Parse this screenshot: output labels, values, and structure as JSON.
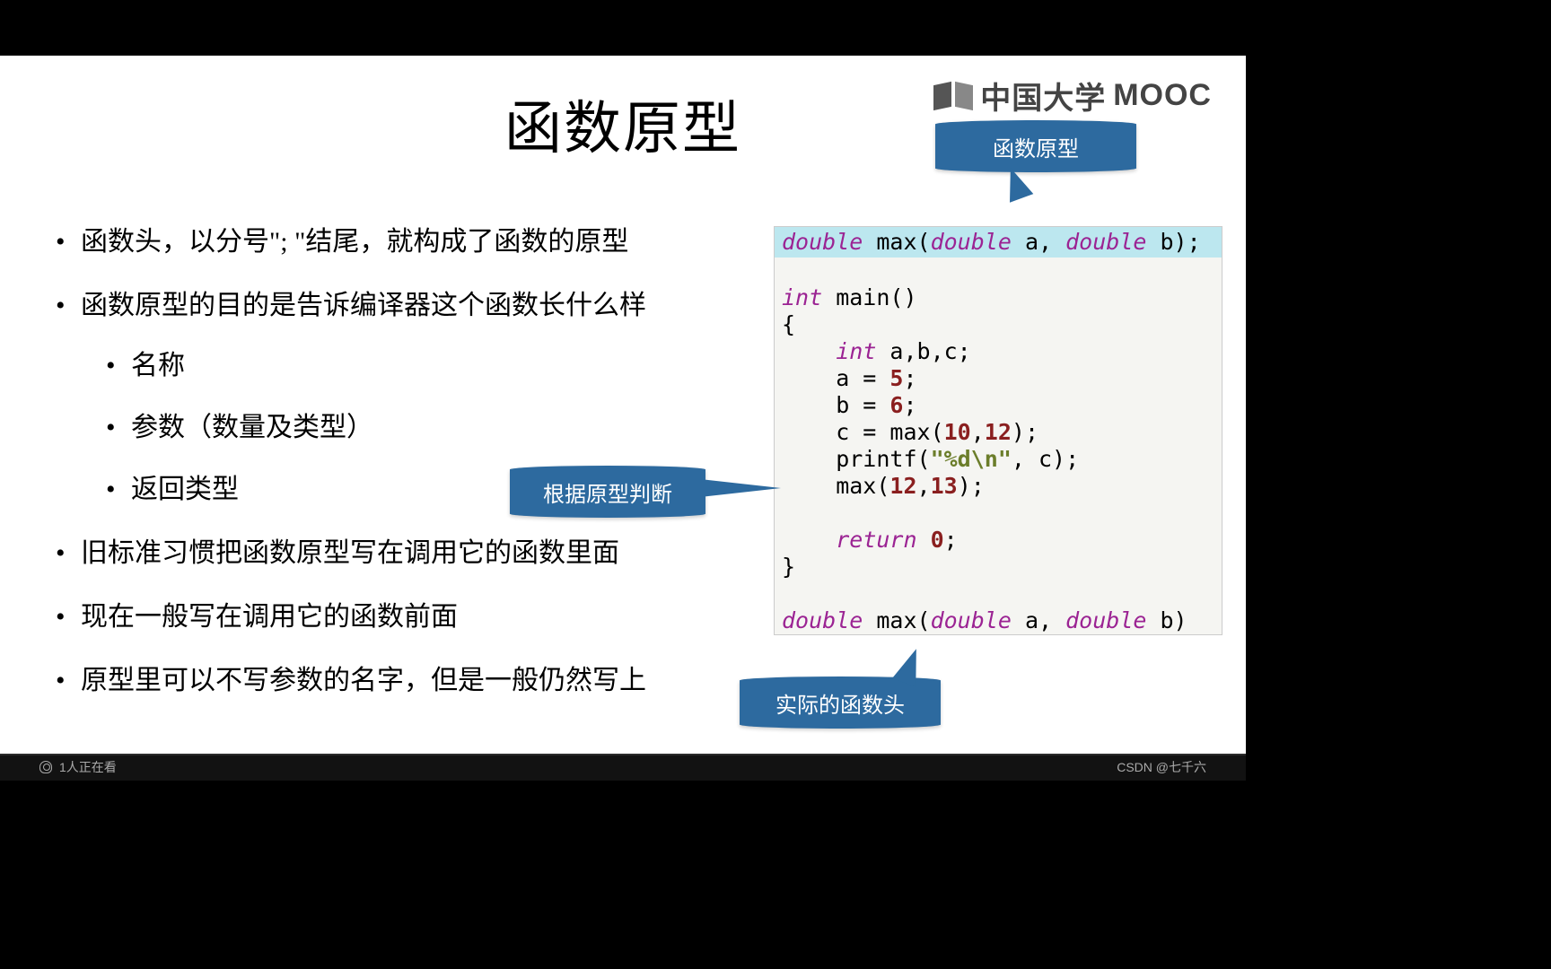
{
  "slide": {
    "title": "函数原型",
    "bullets": {
      "b1": "函数头，以分号\"; \"结尾，就构成了函数的原型",
      "b2": "函数原型的目的是告诉编译器这个函数长什么样",
      "b2a": "名称",
      "b2b": "参数（数量及类型）",
      "b2c": "返回类型",
      "b3": "旧标准习惯把函数原型写在调用它的函数里面",
      "b4": "现在一般写在调用它的函数前面",
      "b5": "原型里可以不写参数的名字，但是一般仍然写上"
    },
    "callouts": {
      "c1": "函数原型",
      "c2": "根据原型判断",
      "c3": "实际的函数头"
    },
    "code": {
      "proto_kw1": "double",
      "proto_fn": " max(",
      "proto_kw2": "double",
      "proto_a": " a, ",
      "proto_kw3": "double",
      "proto_b": " b);",
      "main_kw": "int",
      "main_sig": " main()",
      "brace_open": "{",
      "decl_kw": "int",
      "decl": " a,b,c;",
      "assign_a_l": "    a = ",
      "assign_a_n": "5",
      "semi": ";",
      "assign_b_l": "    b = ",
      "assign_b_n": "6",
      "assign_c_l": "    c = max(",
      "assign_c_n1": "10",
      "comma": ",",
      "assign_c_n2": "12",
      "rparen_semi": ");",
      "printf_l": "    printf(",
      "printf_str": "\"%d\\n\"",
      "printf_r": ", c);",
      "max_call_l": "    max(",
      "max_call_n1": "12",
      "max_call_n2": "13",
      "return_kw": "return",
      "return_sp": "    ",
      "return_n": "0",
      "brace_close": "}",
      "def_kw1": "double",
      "def_fn": " max(",
      "def_kw2": "double",
      "def_a": " a, ",
      "def_kw3": "double",
      "def_b": " b)"
    }
  },
  "logo": {
    "cn": "中国大学",
    "en": "MOOC"
  },
  "footer": {
    "viewers": "1人正在看",
    "credit": "CSDN @七千六"
  }
}
